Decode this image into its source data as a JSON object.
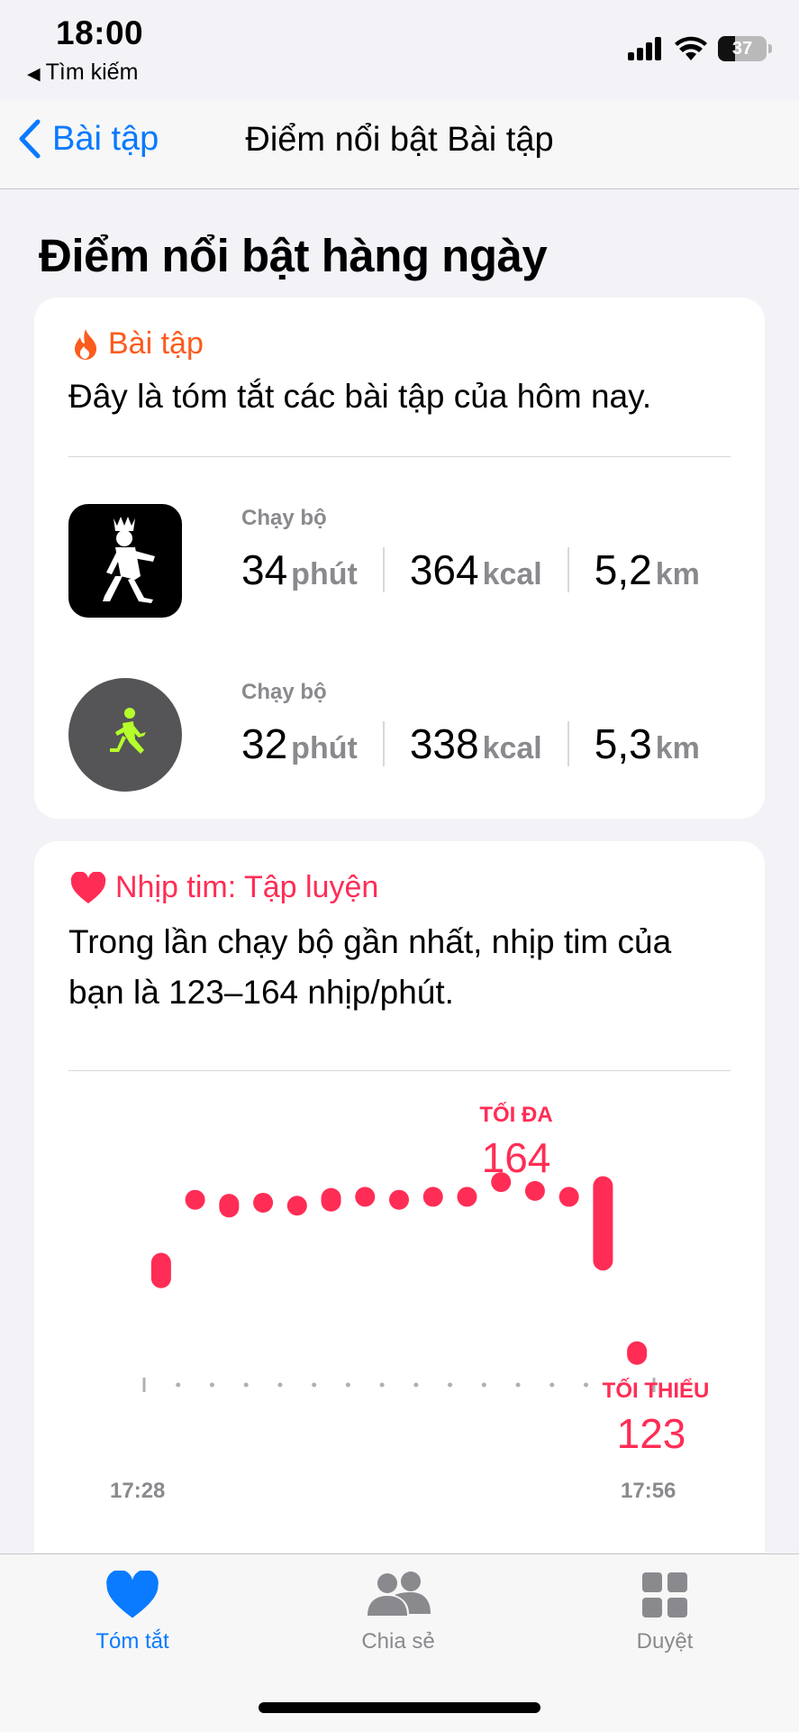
{
  "status_bar": {
    "time": "18:00",
    "back_app": "Tìm kiếm",
    "battery": "37"
  },
  "nav": {
    "back_label": "Bài tập",
    "title": "Điểm nổi bật Bài tập"
  },
  "section_title": "Điểm nổi bật hàng ngày",
  "workout_card": {
    "header": "Bài tập",
    "description": "Đây là tóm tắt các bài tập của hôm nay.",
    "workouts": [
      {
        "name": "Chạy bộ",
        "icon": "walking-figure-icon",
        "time": "34",
        "time_unit": "phút",
        "energy": "364",
        "energy_unit": "kcal",
        "distance": "5,2",
        "distance_unit": "km"
      },
      {
        "name": "Chạy bộ",
        "icon": "runner-icon",
        "time": "32",
        "time_unit": "phút",
        "energy": "338",
        "energy_unit": "kcal",
        "distance": "5,3",
        "distance_unit": "km"
      }
    ]
  },
  "heart_card": {
    "header": "Nhịp tim: Tập luyện",
    "description": "Trong lần chạy bộ gần nhất, nhịp tim của bạn là 123–164 nhịp/phút.",
    "max_label": "TỐI ĐA",
    "max_value": "164",
    "min_label": "TỐI THIỂU",
    "min_value": "123"
  },
  "chart_data": {
    "type": "range-bar",
    "x_start": "17:28",
    "x_end": "17:56",
    "ylim": [
      118,
      170
    ],
    "series": [
      {
        "color": "#ff2d55",
        "ranges": [
          [
            137,
            143
          ],
          [
            151,
            153
          ],
          [
            149,
            153
          ],
          [
            150,
            153
          ],
          [
            150,
            152
          ],
          [
            150,
            154
          ],
          [
            151,
            154
          ],
          [
            151,
            153
          ],
          [
            151,
            154
          ],
          [
            151,
            154
          ],
          [
            154,
            156
          ],
          [
            152,
            155
          ],
          [
            151,
            154
          ],
          [
            140,
            156
          ],
          [
            124,
            128
          ]
        ]
      }
    ],
    "max": 164,
    "min": 123
  },
  "tabs": [
    {
      "label": "Tóm tắt",
      "icon": "heart-icon",
      "active": true
    },
    {
      "label": "Chia sẻ",
      "icon": "people-icon",
      "active": false
    },
    {
      "label": "Duyệt",
      "icon": "grid-icon",
      "active": false
    }
  ]
}
